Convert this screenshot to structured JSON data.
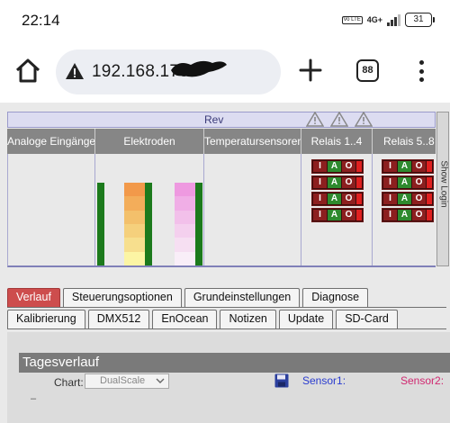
{
  "status_bar": {
    "time": "22:14",
    "volte": "Vo LTE",
    "network": "4G+",
    "battery": "31"
  },
  "browser": {
    "url": "192.168.178",
    "tab_count": "88"
  },
  "grid": {
    "rev_label": "Rev",
    "headers": [
      "Analoge Eingänge",
      "Elektroden",
      "Temperatursensoren",
      "Relais 1..4",
      "Relais 5..8"
    ],
    "relay_labels": [
      "I",
      "A",
      "O"
    ],
    "colors": {
      "header_bg": "#868686",
      "gauge_left": [
        "#f2994a",
        "#f3ad5a",
        "#f3c06b",
        "#f5d07c",
        "#f7df8e",
        "#fcf5a4"
      ],
      "gauge_right": [
        "#ee99e0",
        "#f0aee6",
        "#f2c0ea",
        "#f4d0ee",
        "#f6dff2",
        "#f9eef8"
      ]
    }
  },
  "side_tab": {
    "label": "Show Login"
  },
  "tabs_primary": [
    "Verlauf",
    "Steuerungsoptionen",
    "Grundeinstellungen",
    "Diagnose"
  ],
  "tabs_secondary": [
    "Kalibrierung",
    "DMX512",
    "EnOcean",
    "Notizen",
    "Update",
    "SD-Card"
  ],
  "panel": {
    "title": "Tagesverlauf",
    "chart_label": "Chart:",
    "chart_value": "DualScale",
    "sensor1": "Sensor1:",
    "sensor2": "Sensor2:",
    "dash": "–"
  }
}
